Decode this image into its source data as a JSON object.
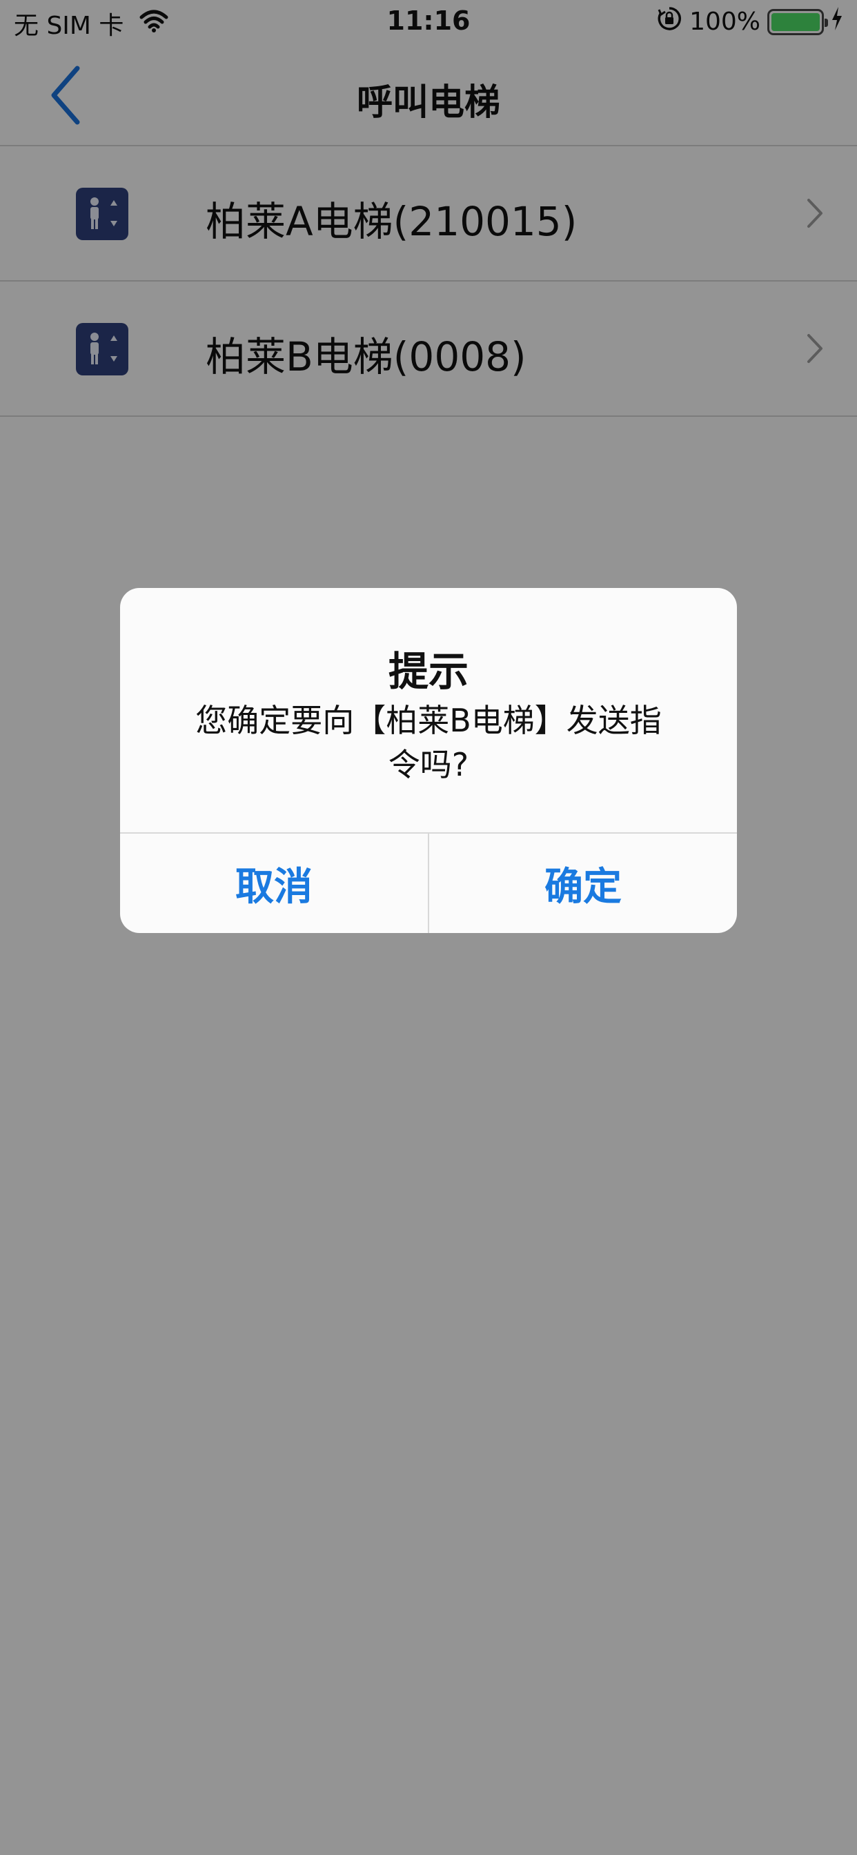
{
  "status_bar": {
    "carrier": "无 SIM 卡",
    "time": "11:16",
    "battery": "100%",
    "battery_level": 1.0
  },
  "nav": {
    "title": "呼叫电梯"
  },
  "list": {
    "items": [
      {
        "label": "柏莱A电梯(210015)",
        "icon": "elevator-icon"
      },
      {
        "label": "柏莱B电梯(0008)",
        "icon": "elevator-icon"
      }
    ]
  },
  "alert": {
    "title": "提示",
    "message_line1": "您确定要向【柏莱B电梯】发送指",
    "message_line2": "令吗?",
    "cancel_label": "取消",
    "confirm_label": "确定"
  },
  "colors": {
    "accent": "#1a7ae0",
    "icon_bg": "#2d3e78",
    "battery_fill": "#4cd964"
  }
}
